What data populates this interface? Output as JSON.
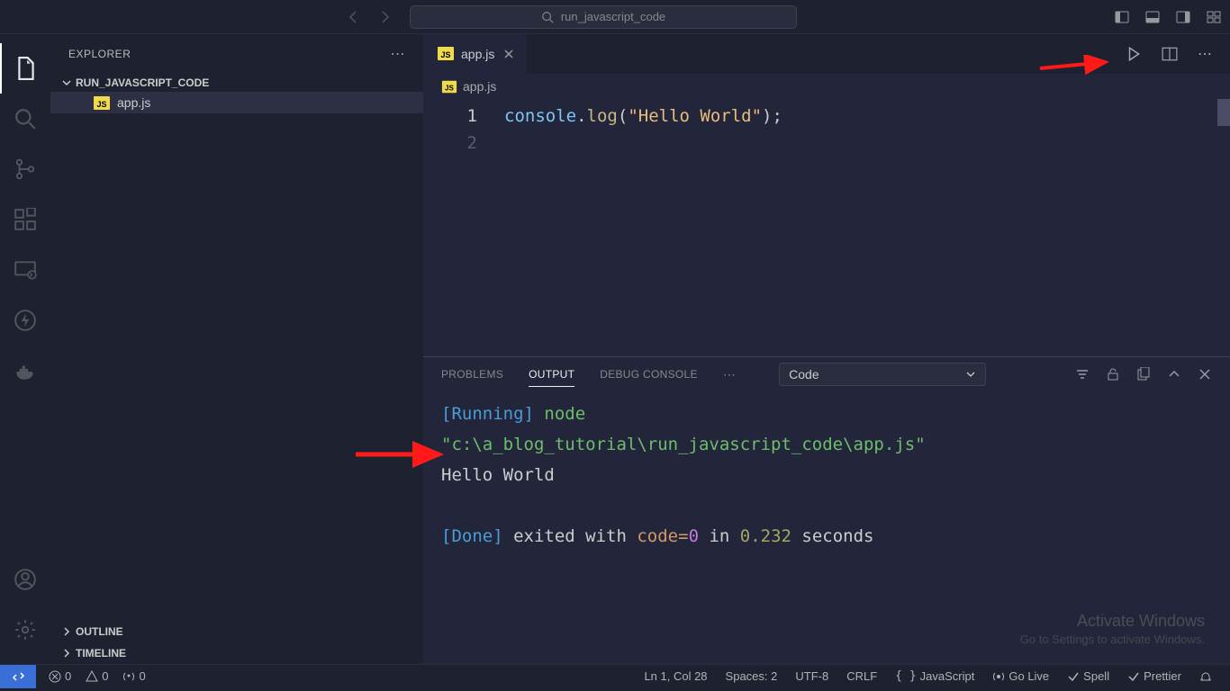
{
  "search": {
    "placeholder": "run_javascript_code"
  },
  "sidebar": {
    "title": "EXPLORER",
    "folder": "RUN_JAVASCRIPT_CODE",
    "file": "app.js",
    "outline": "OUTLINE",
    "timeline": "TIMELINE"
  },
  "tabs": {
    "active": "app.js"
  },
  "breadcrumb": "app.js",
  "code": {
    "line1_obj": "console",
    "line1_fn": "log",
    "line1_str": "\"Hello World\"",
    "ln1": "1",
    "ln2": "2"
  },
  "panel": {
    "problems": "PROBLEMS",
    "output": "OUTPUT",
    "debug": "DEBUG CONSOLE",
    "dropdown": "Code"
  },
  "output": {
    "running": "[Running]",
    "node": " node ",
    "path": "\"c:\\a_blog_tutorial\\run_javascript_code\\app.js\"",
    "hello": "Hello World",
    "done": "[Done]",
    "exited": " exited with ",
    "code_eq": "code=",
    "zero": "0",
    "in_txt": " in ",
    "time": "0.232",
    "seconds": " seconds"
  },
  "watermark": {
    "t1": "Activate Windows",
    "t2": "Go to Settings to activate Windows."
  },
  "status": {
    "errors": "0",
    "warnings": "0",
    "ports": "0",
    "lncol": "Ln 1, Col 28",
    "spaces": "Spaces: 2",
    "encoding": "UTF-8",
    "eol": "CRLF",
    "lang": "JavaScript",
    "golive": "Go Live",
    "spell": "Spell",
    "prettier": "Prettier"
  }
}
